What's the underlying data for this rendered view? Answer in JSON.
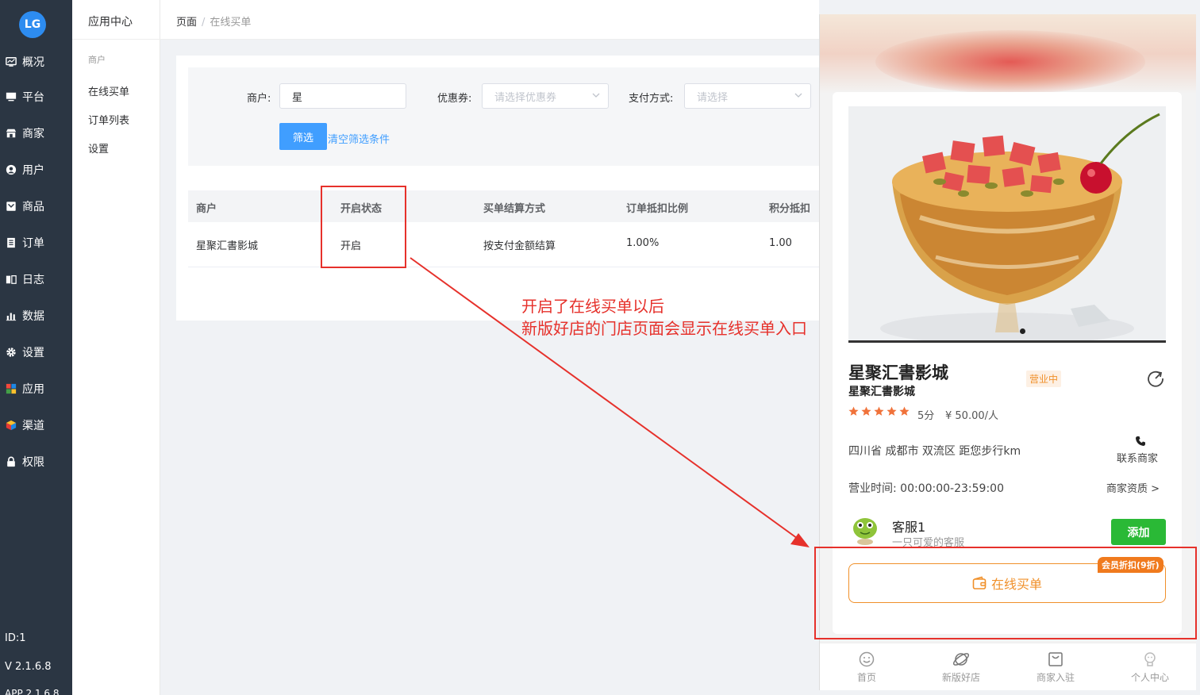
{
  "sidebar": {
    "logo_text": "LG",
    "items": [
      {
        "label": "概况",
        "icon": "monitor-icon"
      },
      {
        "label": "平台",
        "icon": "desktop-icon"
      },
      {
        "label": "商家",
        "icon": "store-icon"
      },
      {
        "label": "用户",
        "icon": "user-icon"
      },
      {
        "label": "商品",
        "icon": "product-icon"
      },
      {
        "label": "订单",
        "icon": "order-icon"
      },
      {
        "label": "日志",
        "icon": "log-icon"
      },
      {
        "label": "数据",
        "icon": "chart-icon"
      },
      {
        "label": "设置",
        "icon": "gear-icon"
      },
      {
        "label": "应用",
        "icon": "apps-icon"
      },
      {
        "label": "渠道",
        "icon": "cube-icon"
      },
      {
        "label": "权限",
        "icon": "lock-icon"
      }
    ],
    "id_text": "ID:1",
    "version": "V 2.1.6.8",
    "app_version": "APP 2.1.6.8"
  },
  "subsidebar": {
    "title": "应用中心",
    "group": "商户",
    "items": [
      "在线买单",
      "订单列表",
      "设置"
    ]
  },
  "breadcrumb": {
    "root": "页面",
    "separator": "/",
    "current": "在线买单"
  },
  "filter": {
    "merchant_label": "商户:",
    "merchant_value": "星",
    "coupon_label": "优惠券:",
    "coupon_placeholder": "请选择优惠券",
    "pay_label": "支付方式:",
    "pay_placeholder": "请选择",
    "submit_label": "筛选",
    "clear_label": "清空筛选条件"
  },
  "table": {
    "headers": [
      "商户",
      "开启状态",
      "买单结算方式",
      "订单抵扣比例",
      "积分抵扣"
    ],
    "rows": [
      [
        "星聚汇書影城",
        "开启",
        "按支付金额结算",
        "1.00%",
        "1.00"
      ]
    ]
  },
  "annotation": {
    "line1": "开启了在线买单以后",
    "line2": "新版好店的门店页面会显示在线买单入口",
    "color": "#e6312b"
  },
  "shop": {
    "name": "星聚汇書影城",
    "subname": "星聚汇書影城",
    "status": "营业中",
    "rating_stars": 5,
    "score": "5分",
    "avg_price": "¥ 50.00/人",
    "address": "四川省 成都市 双流区 距您步行km",
    "contact_label": "联系商家",
    "hours": "营业时间: 00:00:00-23:59:00",
    "qualification": "商家资质 >",
    "cs_name": "客服1",
    "cs_desc": "一只可爱的客服",
    "cs_add": "添加",
    "buy_label": "在线买单",
    "member_badge": "会员折扣(9折)",
    "accent": "#f0902a"
  },
  "tabbar": [
    {
      "label": "首页",
      "icon": "smile-icon"
    },
    {
      "label": "新版好店",
      "icon": "planet-icon"
    },
    {
      "label": "商家入驻",
      "icon": "bag-icon"
    },
    {
      "label": "个人中心",
      "icon": "person-icon"
    }
  ]
}
